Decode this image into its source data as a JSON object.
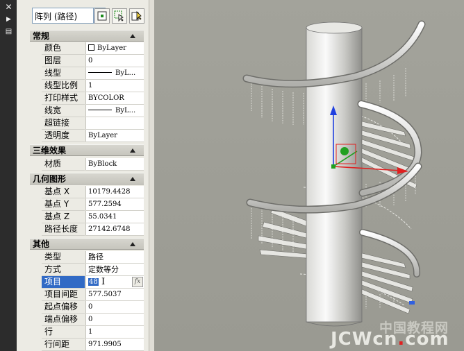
{
  "toolbar": {
    "object_type": "阵列 (路径)",
    "dropdown_icon": "chevron-down-icon",
    "buttons": [
      "toggle-pickadd-icon",
      "select-objects-icon",
      "quick-select-icon"
    ]
  },
  "sections": {
    "general": {
      "title": "常规",
      "rows": [
        {
          "name": "颜色",
          "value": "ByLayer"
        },
        {
          "name": "图层",
          "value": "0"
        },
        {
          "name": "线型",
          "value": "ByL..."
        },
        {
          "name": "线型比例",
          "value": "1"
        },
        {
          "name": "打印样式",
          "value": "BYCOLOR"
        },
        {
          "name": "线宽",
          "value": "ByL..."
        },
        {
          "name": "超链接",
          "value": ""
        },
        {
          "name": "透明度",
          "value": "ByLayer"
        }
      ]
    },
    "effects3d": {
      "title": "三维效果",
      "rows": [
        {
          "name": "材质",
          "value": "ByBlock"
        }
      ]
    },
    "geometry": {
      "title": "几何图形",
      "rows": [
        {
          "name": "基点 X",
          "value": "10179.4428"
        },
        {
          "name": "基点 Y",
          "value": "577.2594"
        },
        {
          "name": "基点 Z",
          "value": "55.0341"
        },
        {
          "name": "路径长度",
          "value": "27142.6748"
        }
      ]
    },
    "misc": {
      "title": "其他",
      "rows": [
        {
          "name": "类型",
          "value": "路径"
        },
        {
          "name": "方式",
          "value": "定数等分"
        },
        {
          "name": "项目",
          "value": "48"
        },
        {
          "name": "项目间距",
          "value": "577.5037"
        },
        {
          "name": "起点偏移",
          "value": "0"
        },
        {
          "name": "端点偏移",
          "value": "0"
        },
        {
          "name": "行",
          "value": "1"
        },
        {
          "name": "行间距",
          "value": "971.9905"
        }
      ]
    }
  },
  "watermark": {
    "cn": "中国教程网",
    "en_a": "JCWcn",
    "en_dot": ".",
    "en_b": "com"
  },
  "colors": {
    "selection": "#316ac5",
    "viewport_bg": "#9c9c94",
    "axis_x": "#e02020",
    "axis_y": "#20a020",
    "axis_z": "#2040e0"
  }
}
